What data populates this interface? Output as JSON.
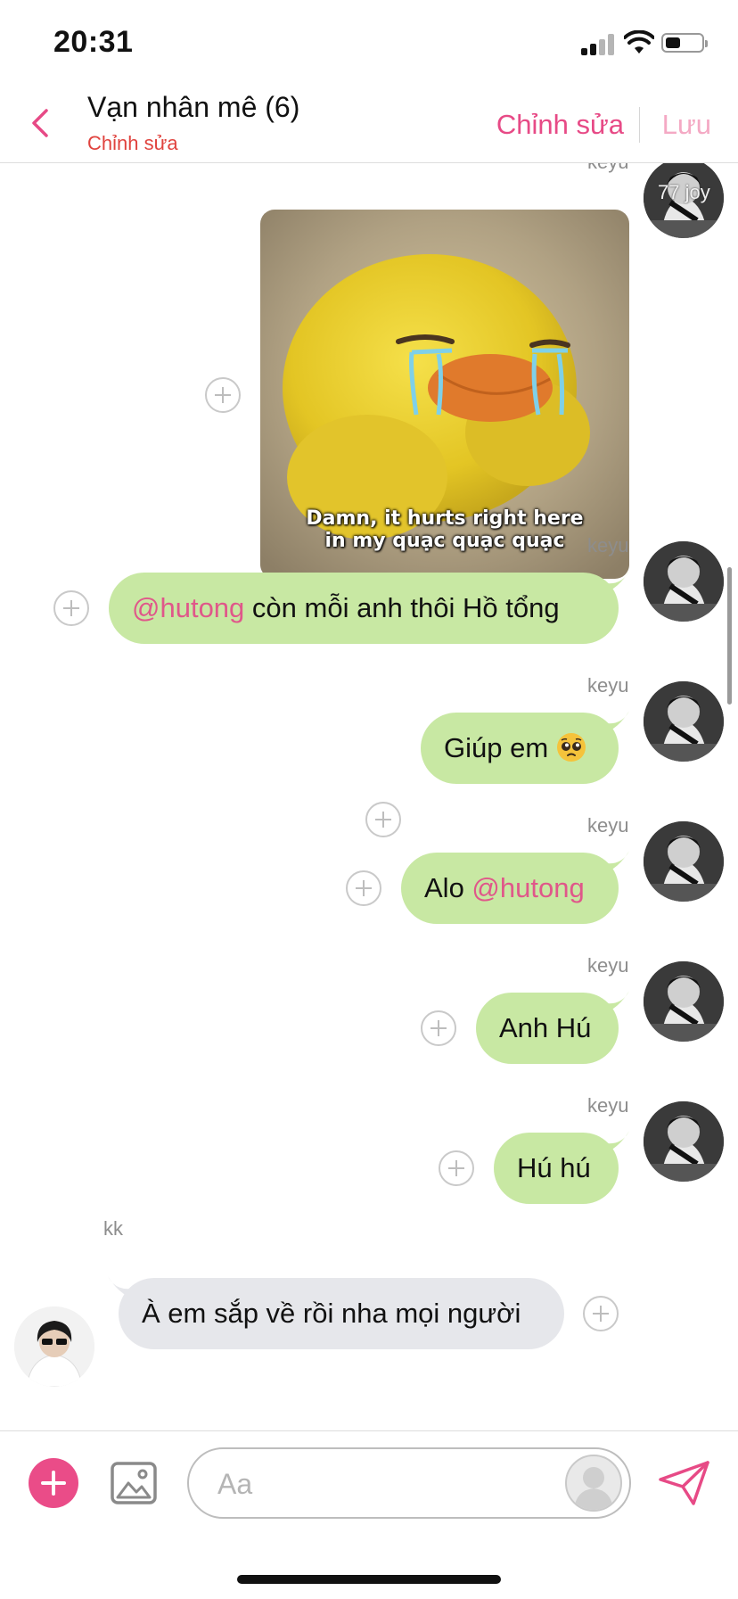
{
  "status_bar": {
    "time": "20:31"
  },
  "header": {
    "title": "Vạn nhân mê (6)",
    "subtitle": "Chỉnh sửa",
    "edit_label": "Chỉnh sửa",
    "save_label": "Lưu"
  },
  "messages": [
    {
      "sender": "keyu",
      "type": "image",
      "caption_line1": "Damn, it hurts right here",
      "caption_line2": "in my quạc quạc quạc",
      "avatar_overlay": "77 joy"
    },
    {
      "sender": "keyu",
      "type": "text",
      "mention": "@hutong",
      "text": " còn mỗi anh thôi Hồ tổng"
    },
    {
      "sender": "keyu",
      "type": "text",
      "text": "Giúp em",
      "emoji": "pleading-face"
    },
    {
      "sender": "keyu",
      "type": "text",
      "text": "Alo ",
      "mention": "@hutong"
    },
    {
      "sender": "keyu",
      "type": "text",
      "text": "Anh Hú"
    },
    {
      "sender": "keyu",
      "type": "text",
      "text": "Hú hú"
    },
    {
      "sender": "kk",
      "type": "text",
      "incoming": true,
      "text": "À em sắp về rồi nha mọi người"
    }
  ],
  "composer": {
    "placeholder": "Aa"
  },
  "colors": {
    "accent": "#ea4c88",
    "outgoing_bubble": "#c8e8a3",
    "incoming_bubble": "#e6e7eb",
    "mention": "#e0578a",
    "subtitle": "#e0433e"
  },
  "icons": [
    "back-chevron-icon",
    "add-icon",
    "gallery-icon",
    "sticker-icon",
    "send-icon",
    "plus-circle-icon"
  ]
}
